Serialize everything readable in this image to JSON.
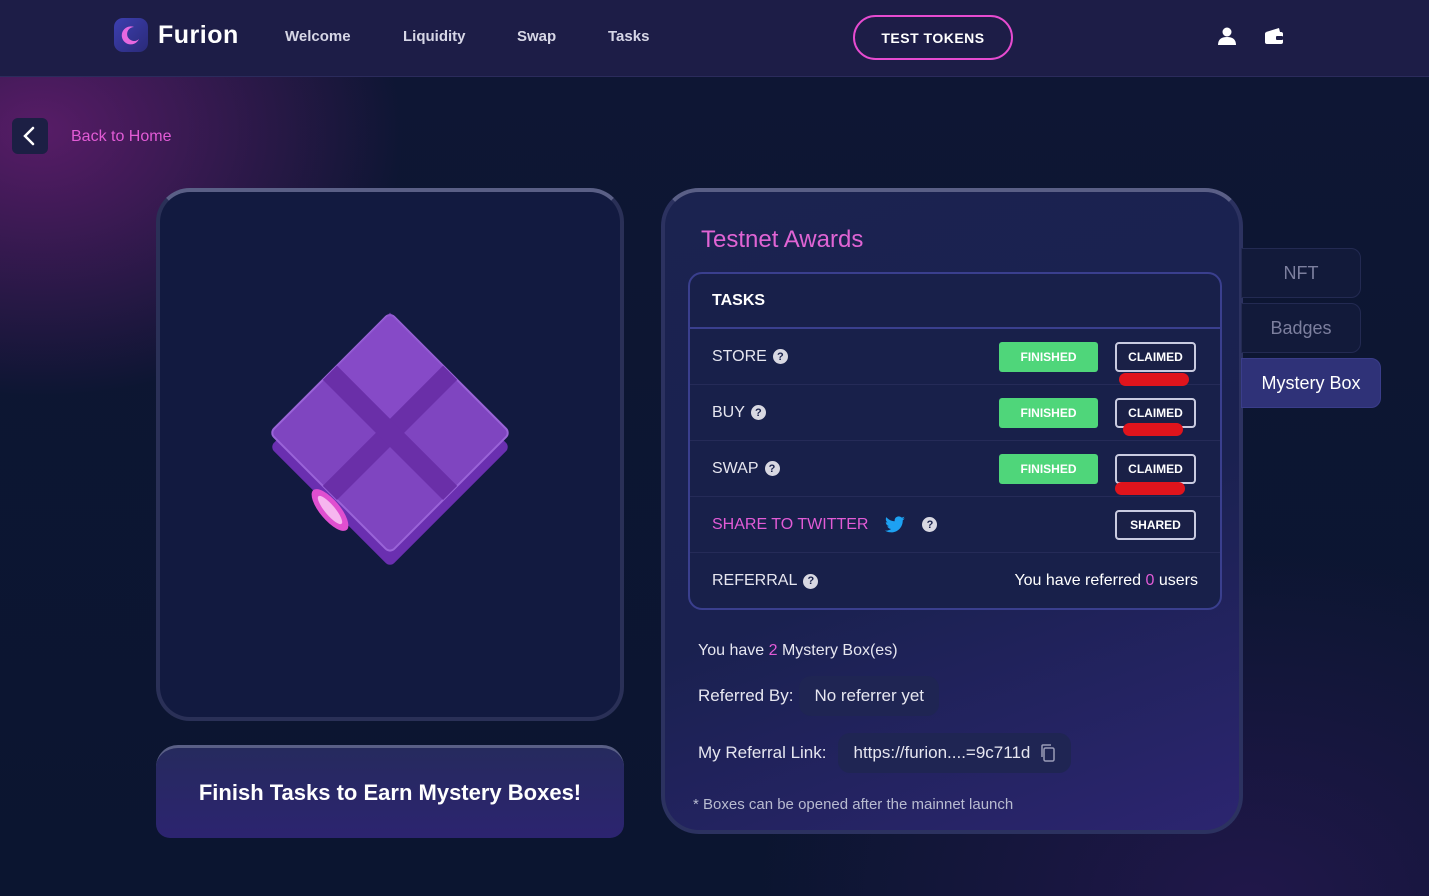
{
  "header": {
    "brand": "Furion",
    "nav": [
      "Welcome",
      "Liquidity",
      "Swap",
      "Tasks"
    ],
    "test_tokens_label": "TEST TOKENS",
    "icons": [
      "user-icon",
      "wallet-icon"
    ]
  },
  "back": {
    "label": "Back to Home"
  },
  "left_card": {
    "banner": "Finish Tasks to Earn Mystery Boxes!"
  },
  "awards": {
    "title": "Testnet Awards",
    "tasks_header": "TASKS",
    "tasks": [
      {
        "label": "STORE",
        "status": "FINISHED",
        "action": "CLAIMED"
      },
      {
        "label": "BUY",
        "status": "FINISHED",
        "action": "CLAIMED"
      },
      {
        "label": "SWAP",
        "status": "FINISHED",
        "action": "CLAIMED"
      }
    ],
    "share": {
      "label": "SHARE TO TWITTER",
      "action": "SHARED"
    },
    "referral": {
      "label": "REFERRAL",
      "prefix": "You have referred",
      "count": "0",
      "suffix": "users"
    },
    "mystery": {
      "prefix": "You have",
      "count": "2",
      "suffix": "Mystery Box(es)"
    },
    "referred_by": {
      "label": "Referred By:",
      "value": "No referrer yet"
    },
    "referral_link": {
      "label": "My Referral Link:",
      "value": "https://furion....=9c711d"
    },
    "footnote": "* Boxes can be opened after the mainnet launch"
  },
  "side_tabs": [
    "NFT",
    "Badges",
    "Mystery Box"
  ],
  "colors": {
    "accent_pink": "#e25bd6",
    "finished_green": "#4fd67a",
    "bg": "#0b1530",
    "header": "#1d1d47"
  }
}
